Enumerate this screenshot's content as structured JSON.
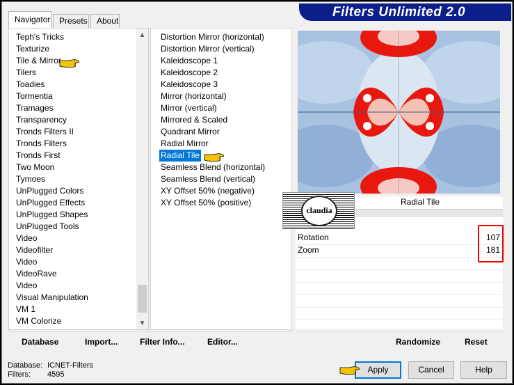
{
  "app": {
    "title": "Filters Unlimited 2.0"
  },
  "tabs": [
    {
      "label": "Navigator"
    },
    {
      "label": "Presets"
    },
    {
      "label": "About"
    }
  ],
  "categories": [
    {
      "label": "Teph's Tricks"
    },
    {
      "label": "Texturize"
    },
    {
      "label": "Tile & Mirror"
    },
    {
      "label": "Tilers"
    },
    {
      "label": "Toadies"
    },
    {
      "label": "Tormentia"
    },
    {
      "label": "Tramages"
    },
    {
      "label": "Transparency"
    },
    {
      "label": "Tronds Filters II"
    },
    {
      "label": "Tronds Filters"
    },
    {
      "label": "Tronds First"
    },
    {
      "label": "Two Moon"
    },
    {
      "label": "Tymoes"
    },
    {
      "label": "UnPlugged Colors"
    },
    {
      "label": "UnPlugged Effects"
    },
    {
      "label": "UnPlugged Shapes"
    },
    {
      "label": "UnPlugged Tools"
    },
    {
      "label": "Video"
    },
    {
      "label": "Videofilter"
    },
    {
      "label": "Video"
    },
    {
      "label": "VideoRave"
    },
    {
      "label": "Video"
    },
    {
      "label": "Visual Manipulation"
    },
    {
      "label": "VM 1"
    },
    {
      "label": "VM Colorize"
    }
  ],
  "filters": [
    {
      "label": "Distortion Mirror (horizontal)"
    },
    {
      "label": "Distortion Mirror (vertical)"
    },
    {
      "label": "Kaleidoscope 1"
    },
    {
      "label": "Kaleidoscope 2"
    },
    {
      "label": "Kaleidoscope 3"
    },
    {
      "label": "Mirror (horizontal)"
    },
    {
      "label": "Mirror (vertical)"
    },
    {
      "label": "Mirrored & Scaled"
    },
    {
      "label": "Quadrant Mirror"
    },
    {
      "label": "Radial Mirror"
    },
    {
      "label": "Radial Tile"
    },
    {
      "label": "Seamless Blend (horizontal)"
    },
    {
      "label": "Seamless Blend (vertical)"
    },
    {
      "label": "XY Offset 50% (negative)"
    },
    {
      "label": "XY Offset 50% (positive)"
    }
  ],
  "selected_category": "Tile & Mirror",
  "selected_filter": "Radial Tile",
  "filter_name": "Radial Tile",
  "watermark_text": "claudia",
  "params": [
    {
      "label": "Rotation",
      "value": "107"
    },
    {
      "label": "Zoom",
      "value": "181"
    }
  ],
  "commands": {
    "database": "Database",
    "import": "Import...",
    "filter_info": "Filter Info...",
    "editor": "Editor...",
    "randomize": "Randomize",
    "reset": "Reset"
  },
  "status": {
    "database_label": "Database:",
    "database_value": "ICNET-Filters",
    "filters_label": "Filters:",
    "filters_value": "4595"
  },
  "buttons": {
    "apply": "Apply",
    "cancel": "Cancel",
    "help": "Help"
  },
  "colors": {
    "banner": "#0c1e8a",
    "selection": "#0078d7",
    "highlight_box": "#ee0000",
    "hand_icon": "#f5c400"
  },
  "icons": {
    "pointer": "pointing-hand-icon",
    "scroll_up": "chevron-up-icon",
    "scroll_down": "chevron-down-icon"
  }
}
